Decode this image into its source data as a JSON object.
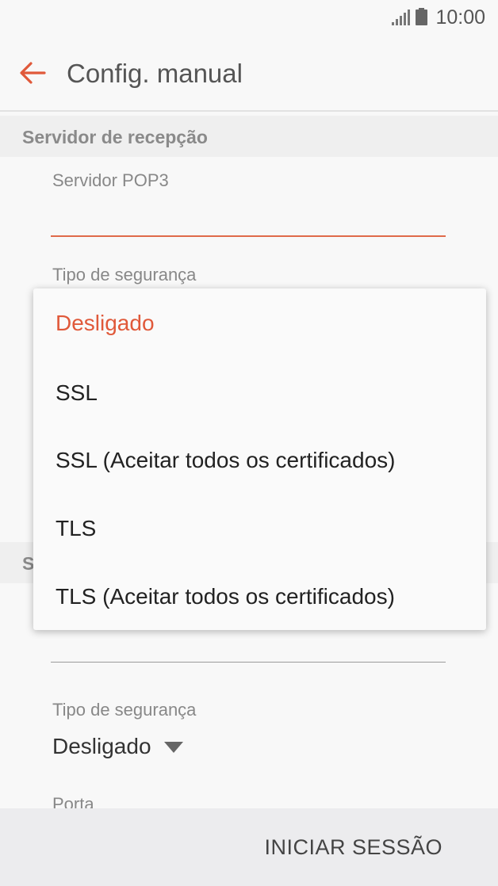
{
  "status_bar": {
    "time": "10:00"
  },
  "app_bar": {
    "title": "Config. manual"
  },
  "incoming": {
    "section_title": "Servidor de recepção",
    "server_label": "Servidor POP3",
    "security_label": "Tipo de segurança"
  },
  "dropdown_menu": {
    "options": [
      {
        "label": "Desligado",
        "selected": true
      },
      {
        "label": "SSL"
      },
      {
        "label": "SSL (Aceitar todos os certificados)"
      },
      {
        "label": "TLS"
      },
      {
        "label": "TLS (Aceitar todos os certificados)"
      }
    ]
  },
  "outgoing": {
    "section_title_partial": "S",
    "security_label": "Tipo de segurança",
    "security_value": "Desligado",
    "port_label": "Porta"
  },
  "footer": {
    "signin_label": "INICIAR SESSÃO"
  },
  "colors": {
    "accent": "#e0593a",
    "background": "#f8f8f8"
  }
}
